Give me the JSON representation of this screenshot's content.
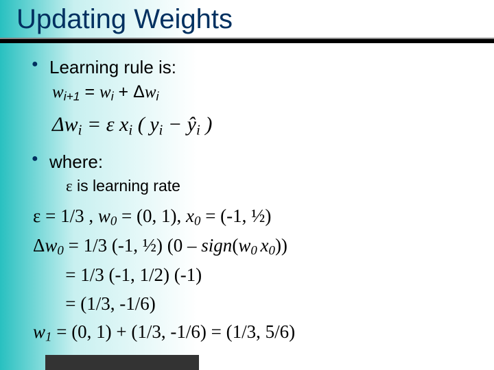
{
  "title": "Updating Weights",
  "bullet1": "Learning rule is:",
  "rule_eq_lhs": "w",
  "rule_eq_sub1": "i+1",
  "rule_eq_mid": " = ",
  "rule_eq_w2": "w",
  "rule_eq_sub2": "i",
  "rule_eq_plus": " + Δ",
  "rule_eq_w3": "w",
  "rule_eq_sub3": "i",
  "delta_formula": "Δw_i = ε x_i ( y_i − ŷ_i )",
  "delta_html_pre": "Δ",
  "delta_w": "w",
  "delta_sub": "i",
  "delta_eq": " = ε ",
  "delta_x": "x",
  "delta_xsub": "i",
  "delta_open": " ( ",
  "delta_y": "y",
  "delta_ysub": "i",
  "delta_minus": " − ",
  "delta_yhat": "ŷ",
  "delta_yhatsub": "i",
  "delta_close": " )",
  "bullet2": "where:",
  "eps_note_sym": "ε",
  "eps_note": " is learning rate",
  "ex1_a": "ε = 1/3 , ",
  "ex1_w": "w",
  "ex1_wsub": "0",
  "ex1_b": " = (0, 1), ",
  "ex1_x": "x",
  "ex1_xsub": "0",
  "ex1_c": " = (-1, ½)",
  "ex2_a": "Δ",
  "ex2_w": "w",
  "ex2_wsub": "0",
  "ex2_b": " = 1/3 (-1, ½) (0 – ",
  "ex2_sign": "sign",
  "ex2_c": "(",
  "ex2_w2": "w",
  "ex2_w2sub": "0 ",
  "ex2_x2": "x",
  "ex2_x2sub": "0",
  "ex2_d": "))",
  "ex3": "       = 1/3 (-1, 1/2) (-1)",
  "ex4": "       = (1/3, -1/6)",
  "ex5_w": "w",
  "ex5_wsub": "1",
  "ex5_a": " = (0, 1) + (1/3, -1/6) = (1/3, 5/6)"
}
